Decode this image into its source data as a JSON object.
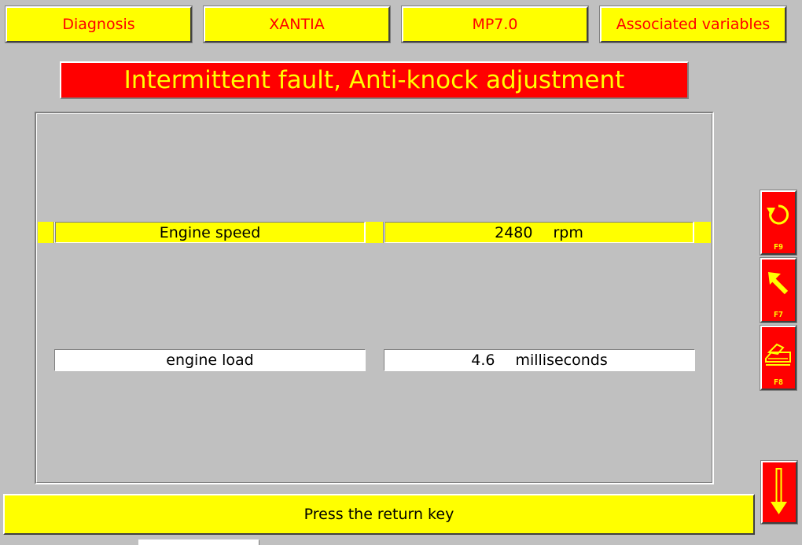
{
  "tabs": {
    "diagnosis": "Diagnosis",
    "vehicle": "XANTIA",
    "ecu": "MP7.0",
    "associated": "Associated variables"
  },
  "title": "Intermittent fault, Anti-knock adjustment",
  "parameters": [
    {
      "label": "Engine speed",
      "value": "2480",
      "unit": "rpm",
      "selected": true
    },
    {
      "label": "engine load",
      "value": "4.6",
      "unit": "milliseconds",
      "selected": false
    }
  ],
  "function_keys": [
    {
      "key": "F9",
      "icon": "refresh-icon"
    },
    {
      "key": "F7",
      "icon": "arrow-up-left-icon"
    },
    {
      "key": "F8",
      "icon": "print-icon"
    }
  ],
  "status": "Press the return key",
  "scroll_icon": "arrow-down-icon",
  "colors": {
    "background": "#c0c0c0",
    "accent_yellow": "#ffff00",
    "accent_red": "#ff0000",
    "field_white": "#ffffff"
  }
}
